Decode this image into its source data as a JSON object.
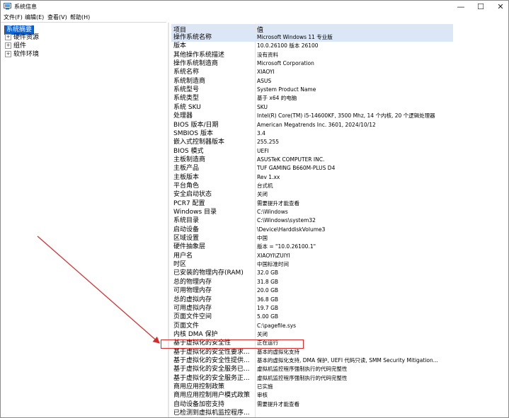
{
  "window": {
    "title": "系统信息",
    "controls": [
      "—",
      "☐",
      "✕"
    ]
  },
  "menu": [
    "文件(F)",
    "编辑(E)",
    "查看(V)",
    "帮助(H)"
  ],
  "tree": {
    "root": "系统摘要",
    "children": [
      "硬件资源",
      "组件",
      "软件环境"
    ]
  },
  "table": {
    "headers": [
      "项目",
      "值"
    ],
    "rows": [
      {
        "k": "操作系统名称",
        "v": "Microsoft Windows 11 专业版"
      },
      {
        "k": "版本",
        "v": "10.0.26100 版本 26100"
      },
      {
        "k": "其他操作系统描述",
        "v": "没有资料"
      },
      {
        "k": "操作系统制造商",
        "v": "Microsoft Corporation"
      },
      {
        "k": "系统名称",
        "v": "XIAOYI"
      },
      {
        "k": "系统制造商",
        "v": "ASUS"
      },
      {
        "k": "系统型号",
        "v": "System Product Name"
      },
      {
        "k": "系统类型",
        "v": "基于 x64 的电脑"
      },
      {
        "k": "系统 SKU",
        "v": "SKU"
      },
      {
        "k": "处理器",
        "v": "Intel(R) Core(TM) i5-14600KF, 3500 Mhz, 14 个内核, 20 个逻辑处理器"
      },
      {
        "k": "BIOS 版本/日期",
        "v": "American Megatrends Inc. 3601, 2024/10/12"
      },
      {
        "k": "SMBIOS 版本",
        "v": "3.4"
      },
      {
        "k": "嵌入式控制器版本",
        "v": "255.255"
      },
      {
        "k": "BIOS 模式",
        "v": "UEFI"
      },
      {
        "k": "主板制造商",
        "v": "ASUSTeK COMPUTER INC."
      },
      {
        "k": "主板产品",
        "v": "TUF GAMING B660M-PLUS D4"
      },
      {
        "k": "主板版本",
        "v": "Rev 1.xx"
      },
      {
        "k": "平台角色",
        "v": "台式机"
      },
      {
        "k": "安全启动状态",
        "v": "关闭"
      },
      {
        "k": "PCR7 配置",
        "v": "需要提升才能查看"
      },
      {
        "k": "Windows 目录",
        "v": "C:\\Windows"
      },
      {
        "k": "系统目录",
        "v": "C:\\Windows\\system32"
      },
      {
        "k": "启动设备",
        "v": "\\Device\\HarddiskVolume3"
      },
      {
        "k": "区域设置",
        "v": "中国"
      },
      {
        "k": "硬件抽象层",
        "v": "版本 = \"10.0.26100.1\""
      },
      {
        "k": "用户名",
        "v": "XIAOYI\\ZUIYI"
      },
      {
        "k": "时区",
        "v": "中国标准时间"
      },
      {
        "k": "已安装的物理内存(RAM)",
        "v": "32.0 GB"
      },
      {
        "k": "总的物理内存",
        "v": "31.8 GB"
      },
      {
        "k": "可用物理内存",
        "v": "20.0 GB"
      },
      {
        "k": "总的虚拟内存",
        "v": "36.8 GB"
      },
      {
        "k": "可用虚拟内存",
        "v": "19.7 GB"
      },
      {
        "k": "页面文件空间",
        "v": "5.00 GB"
      },
      {
        "k": "页面文件",
        "v": "C:\\pagefile.sys"
      },
      {
        "k": "内核 DMA 保护",
        "v": "关闭"
      },
      {
        "k": "基于虚拟化的安全性",
        "v": "正在运行"
      },
      {
        "k": "基于虚拟化的安全性要求...",
        "v": "基本的虚拟化支持"
      },
      {
        "k": "基于虚拟化的安全性提供...",
        "v": "基本的虚拟化支持, DMA 保护, UEFI 代码只读, SMM Security Mitigation..."
      },
      {
        "k": "基于虚拟化的安全服务已...",
        "v": "虚拟机监控程序强制执行的代码完整性"
      },
      {
        "k": "基于虚拟化的安全服务正...",
        "v": "虚拟机监控程序强制执行的代码完整性"
      },
      {
        "k": "商用应用控制政策",
        "v": "已实施"
      },
      {
        "k": "商用应用控制用户模式政策",
        "v": "审核"
      },
      {
        "k": "自动设备加密支持",
        "v": "需要提升才能查看"
      },
      {
        "k": "已检测到虚拟机监控程序...",
        "v": ""
      }
    ]
  },
  "annotation": {
    "box_color": "#d42b2b",
    "highlighted_row": "基于虚拟化的安全性"
  }
}
